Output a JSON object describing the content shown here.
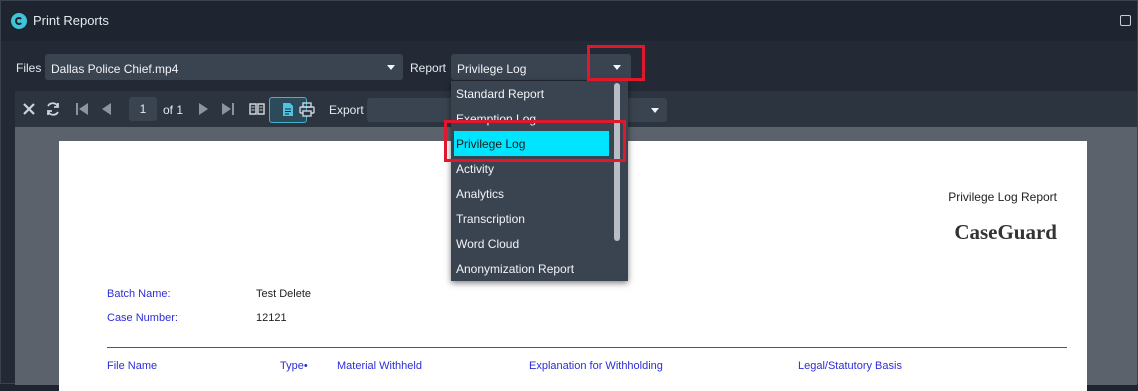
{
  "window": {
    "title": "Print Reports"
  },
  "files": {
    "label": "Files",
    "value": "Dallas Police Chief.mp4"
  },
  "report": {
    "label": "Report",
    "value": "Privilege Log",
    "options": [
      "Standard Report",
      "Exemption Log",
      "Privilege Log",
      "Activity",
      "Analytics",
      "Transcription",
      "Word Cloud",
      "Anonymization Report"
    ],
    "selected_index": 2
  },
  "toolbar": {
    "page": "1",
    "of_text": "of 1",
    "export_label": "Export",
    "export_value": ""
  },
  "report_preview": {
    "report_title": "Privilege Log Report",
    "brand": "CaseGuard",
    "batch_label": "Batch Name:",
    "batch_value": "Test Delete",
    "case_label": "Case Number:",
    "case_value": "12121",
    "columns": [
      "File Name",
      "Type•",
      "Material Withheld",
      "Explanation for Withholding",
      "Legal/Statutory Basis"
    ]
  },
  "colors": {
    "accent": "#00e5ff",
    "highlight": "#e0182d",
    "field_label": "#2d2dd8"
  }
}
